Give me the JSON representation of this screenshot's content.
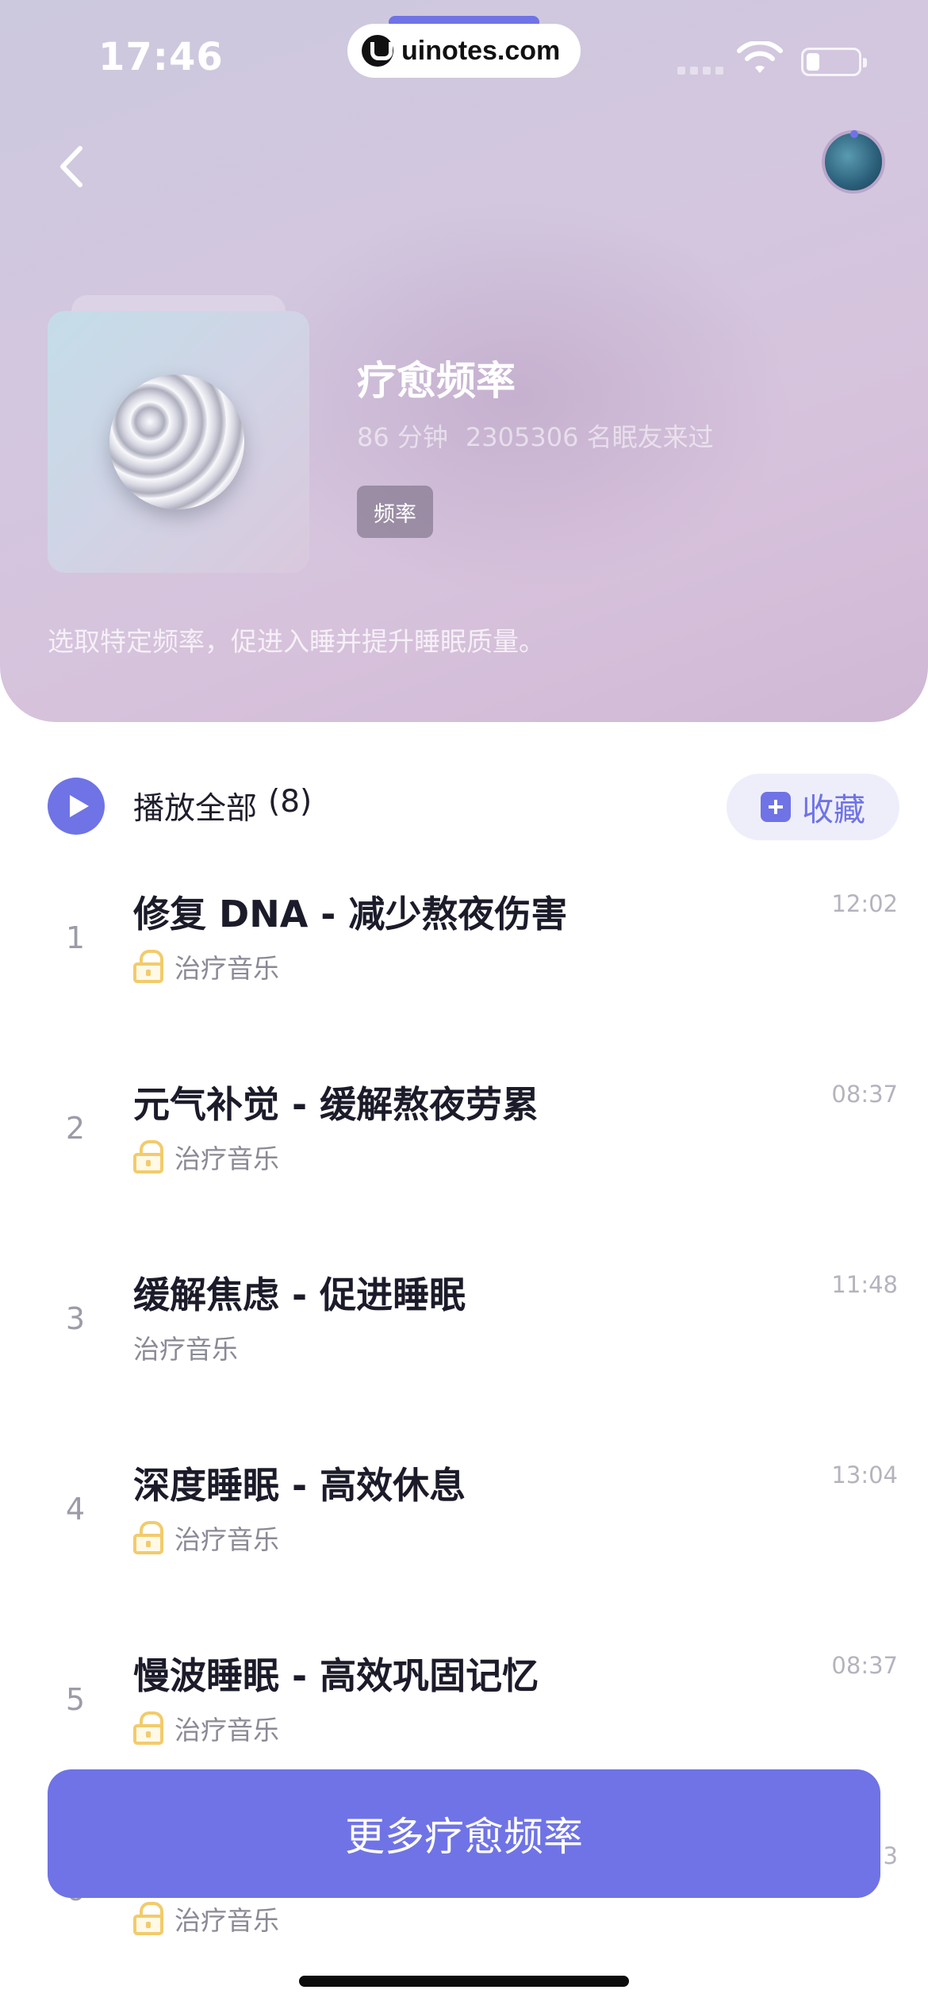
{
  "status_bar": {
    "time": "17:46",
    "watermark": "uinotes.com"
  },
  "header": {
    "title": "疗愈频率",
    "duration": "86 分钟",
    "listeners": "2305306 名眠友来过",
    "tag": "频率",
    "description": "选取特定频率，促进入睡并提升睡眠质量。"
  },
  "play_all": {
    "label": "播放全部",
    "count": "(8)"
  },
  "collect": {
    "label": "收藏"
  },
  "tracks": [
    {
      "num": "1",
      "title": "修复 DNA - 减少熬夜伤害",
      "tag": "治疗音乐",
      "duration": "12:02",
      "locked": true
    },
    {
      "num": "2",
      "title": "元气补觉 - 缓解熬夜劳累",
      "tag": "治疗音乐",
      "duration": "08:37",
      "locked": true
    },
    {
      "num": "3",
      "title": "缓解焦虑 - 促进睡眠",
      "tag": "治疗音乐",
      "duration": "11:48",
      "locked": false
    },
    {
      "num": "4",
      "title": "深度睡眠 - 高效休息",
      "tag": "治疗音乐",
      "duration": "13:04",
      "locked": true
    },
    {
      "num": "5",
      "title": "慢波睡眠 - 高效巩固记忆",
      "tag": "治疗音乐",
      "duration": "08:37",
      "locked": true
    },
    {
      "num": "6",
      "title": "",
      "tag": "治疗音乐",
      "duration": "3",
      "locked": true
    }
  ],
  "cta": {
    "label": "更多疗愈频率"
  },
  "colors": {
    "accent": "#6f73e6",
    "lock": "#f2cb6b",
    "cta_bg": "#6f73e6"
  },
  "icons": {
    "back": "chevron-left-icon",
    "play": "play-icon",
    "collect": "plus-square-icon",
    "lock": "lock-icon"
  }
}
